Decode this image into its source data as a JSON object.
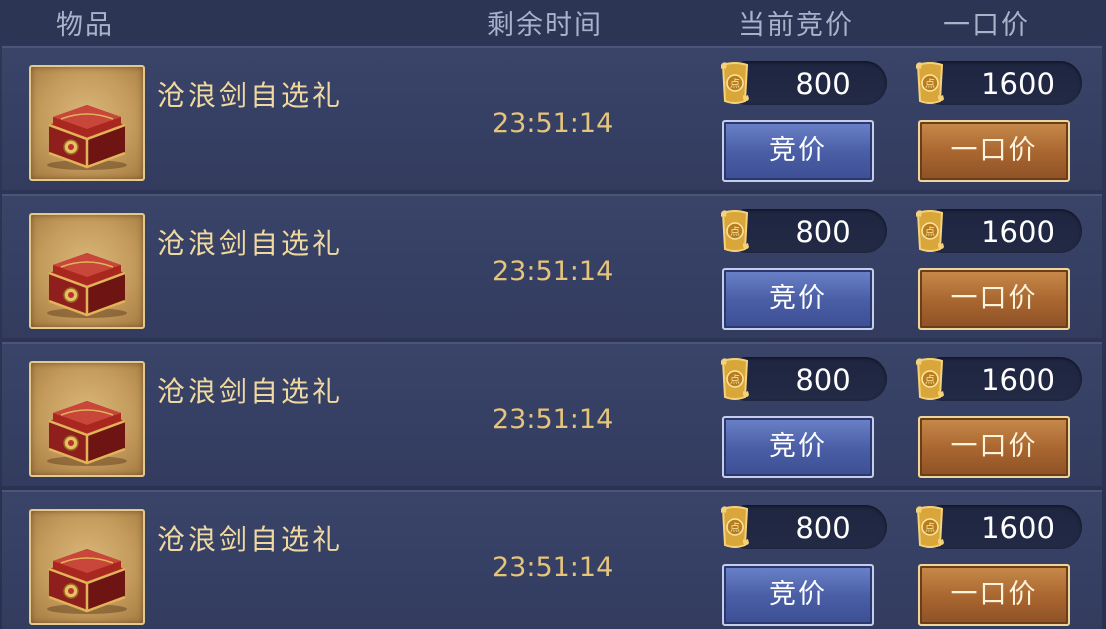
{
  "header": {
    "item": "物品",
    "time": "剩余时间",
    "current_bid": "当前竞价",
    "buyout": "一口价"
  },
  "rows": [
    {
      "name": "沧浪剑自选礼",
      "time_left": "23:51:14",
      "current_bid": "800",
      "buyout": "1600",
      "bid_label": "竞价",
      "buyout_label": "一口价",
      "icon": "treasure-chest-icon"
    },
    {
      "name": "沧浪剑自选礼",
      "time_left": "23:51:14",
      "current_bid": "800",
      "buyout": "1600",
      "bid_label": "竞价",
      "buyout_label": "一口价",
      "icon": "treasure-chest-icon"
    },
    {
      "name": "沧浪剑自选礼",
      "time_left": "23:51:14",
      "current_bid": "800",
      "buyout": "1600",
      "bid_label": "竞价",
      "buyout_label": "一口价",
      "icon": "treasure-chest-icon"
    },
    {
      "name": "沧浪剑自选礼",
      "time_left": "23:51:14",
      "current_bid": "800",
      "buyout": "1600",
      "bid_label": "竞价",
      "buyout_label": "一口价",
      "icon": "treasure-chest-icon"
    }
  ],
  "colors": {
    "background": "#2e3656",
    "row": "#3a4468",
    "gold_text": "#f0d9a0",
    "timer": "#e6c47a",
    "bid_button": "#4b5fa7",
    "buyout_button": "#a8652f"
  },
  "currency_icon": "gold-scroll-icon"
}
